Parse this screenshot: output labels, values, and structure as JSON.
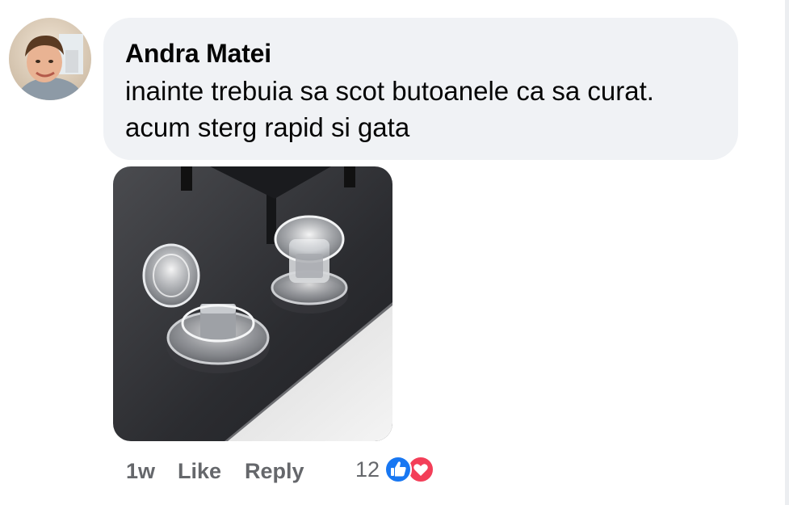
{
  "comment": {
    "author": "Andra Matei",
    "text": "inainte trebuia sa scot butoanele ca sa curat. acum sterg rapid si gata",
    "avatar_icon": "profile-photo",
    "attachment_icon": "stove-knob-covers-photo"
  },
  "actions": {
    "timestamp": "1w",
    "like_label": "Like",
    "reply_label": "Reply"
  },
  "reactions": {
    "count": "12",
    "types": [
      "like-reaction-icon",
      "love-reaction-icon"
    ],
    "like_color": "#1877f2",
    "love_color": "#f33e58"
  },
  "colors": {
    "bubble": "#f0f2f5",
    "secondary_text": "#65676b",
    "primary_text": "#050505"
  }
}
